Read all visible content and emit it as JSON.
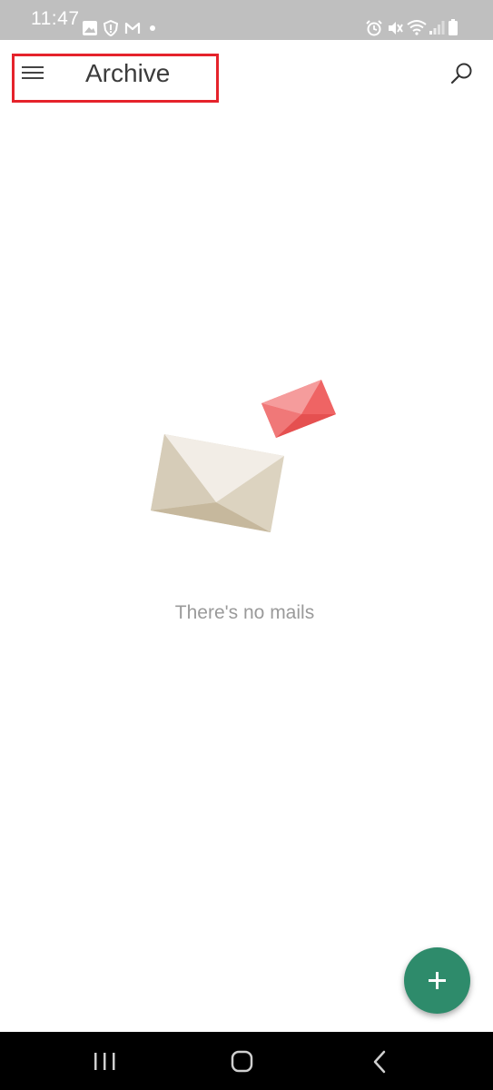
{
  "status_bar": {
    "time": "11:47",
    "left_icons": [
      "gallery-icon",
      "shield-alert-icon",
      "mail-m-icon",
      "dot-icon"
    ],
    "right_icons": [
      "alarm-icon",
      "mute-icon",
      "wifi-icon",
      "signal-icon",
      "battery-icon"
    ]
  },
  "app_bar": {
    "title": "Archive",
    "menu_icon": "hamburger-menu-icon",
    "search_icon": "search-icon",
    "highlight_color": "#e5232b"
  },
  "empty_state": {
    "message": "There's no mails",
    "illustration": "envelopes-illustration"
  },
  "fab": {
    "icon": "plus-icon",
    "color": "#2e8b6b"
  },
  "nav_bar": {
    "buttons": [
      "recent-apps-icon",
      "home-icon",
      "back-icon"
    ]
  }
}
